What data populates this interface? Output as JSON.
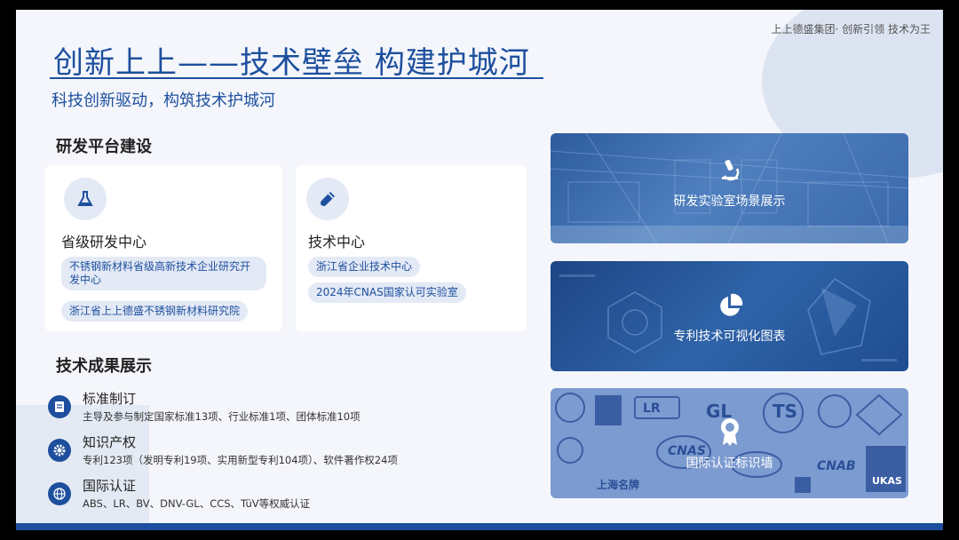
{
  "header": {
    "brand": "上上德盛集团· 创新引领 技术为王",
    "title": "创新上上——技术壁垒 构建护城河",
    "subtitle": "科技创新驱动，构筑技术护城河"
  },
  "rd": {
    "heading": "研发平台建设",
    "cards": [
      {
        "title": "省级研发中心",
        "icon": "flask-icon",
        "items": [
          "不锈钢新材料省级高新技术企业研究开发中心",
          "浙江省上上德盛不锈钢新材料研究院"
        ]
      },
      {
        "title": "技术中心",
        "icon": "test-tube-icon",
        "items": [
          "浙江省企业技术中心",
          "2024年CNAS国家认可实验室"
        ]
      }
    ]
  },
  "achievements": {
    "heading": "技术成果展示",
    "items": [
      {
        "title": "标准制订",
        "desc": "主导及参与制定国家标准13项、行业标准1项、团体标准10项",
        "icon": "document-icon"
      },
      {
        "title": "知识产权",
        "desc": "专利123项（发明专利19项、实用新型专利104项）、软件著作权24项",
        "icon": "gear-icon"
      },
      {
        "title": "国际认证",
        "desc": "ABS、LR、BV、DNV-GL、CCS、TüV等权威认证",
        "icon": "globe-icon"
      }
    ]
  },
  "panels": [
    {
      "label": "研发实验室场景展示",
      "icon": "microscope-icon"
    },
    {
      "label": "专利技术可视化图表",
      "icon": "pie-chart-icon"
    },
    {
      "label": "国际认证标识墙",
      "icon": "certificate-icon"
    }
  ],
  "cert_logos": [
    "GL",
    "TS",
    "LR",
    "CNAS",
    "CNAB",
    "UKAS",
    "上海名牌"
  ],
  "colors": {
    "primary": "#1d4f9e",
    "chip_bg": "#e3e9f5",
    "background": "#f4f6fb"
  }
}
